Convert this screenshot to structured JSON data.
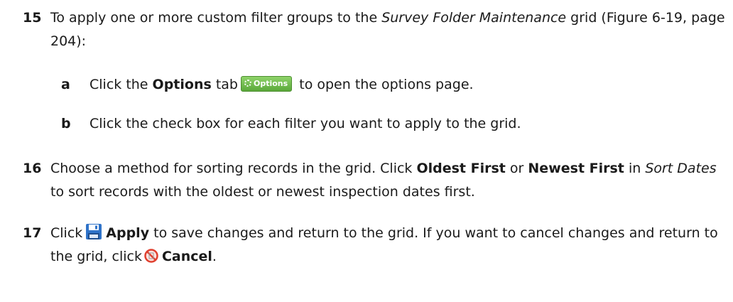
{
  "steps": [
    {
      "number": "15",
      "text_a": "To apply one or more custom filter groups to the ",
      "text_b": "Survey Folder Maintenance",
      "text_c": " grid (Figure 6-19, page 204):",
      "substeps": [
        {
          "letter": "a",
          "text_a": "Click the ",
          "text_b": "Options",
          "text_c": " tab",
          "tab_label": "Options",
          "text_d": " to open the options page."
        },
        {
          "letter": "b",
          "text": "Click the check box for each filter you want to apply to the grid."
        }
      ]
    },
    {
      "number": "16",
      "text_a": "Choose a method for sorting records in the grid. Click ",
      "text_b": "Oldest First",
      "text_c": " or ",
      "text_d": "Newest First",
      "text_e": " in ",
      "text_f": "Sort Dates",
      "text_g": " to sort records with the oldest or newest inspection dates first."
    },
    {
      "number": "17",
      "text_a": "Click",
      "text_b": "Apply",
      "text_c": " to save changes and return to the grid. If you want to cancel changes and return to the grid, click",
      "text_d": "Cancel",
      "text_e": "."
    }
  ],
  "icons": {
    "options_tab": "gear-icon",
    "apply": "floppy-disk-icon",
    "cancel": "cancel-icon"
  },
  "colors": {
    "options_tab": "#6cbf47",
    "apply_icon": "#2f73c9",
    "cancel_icon": "#e0402f"
  }
}
